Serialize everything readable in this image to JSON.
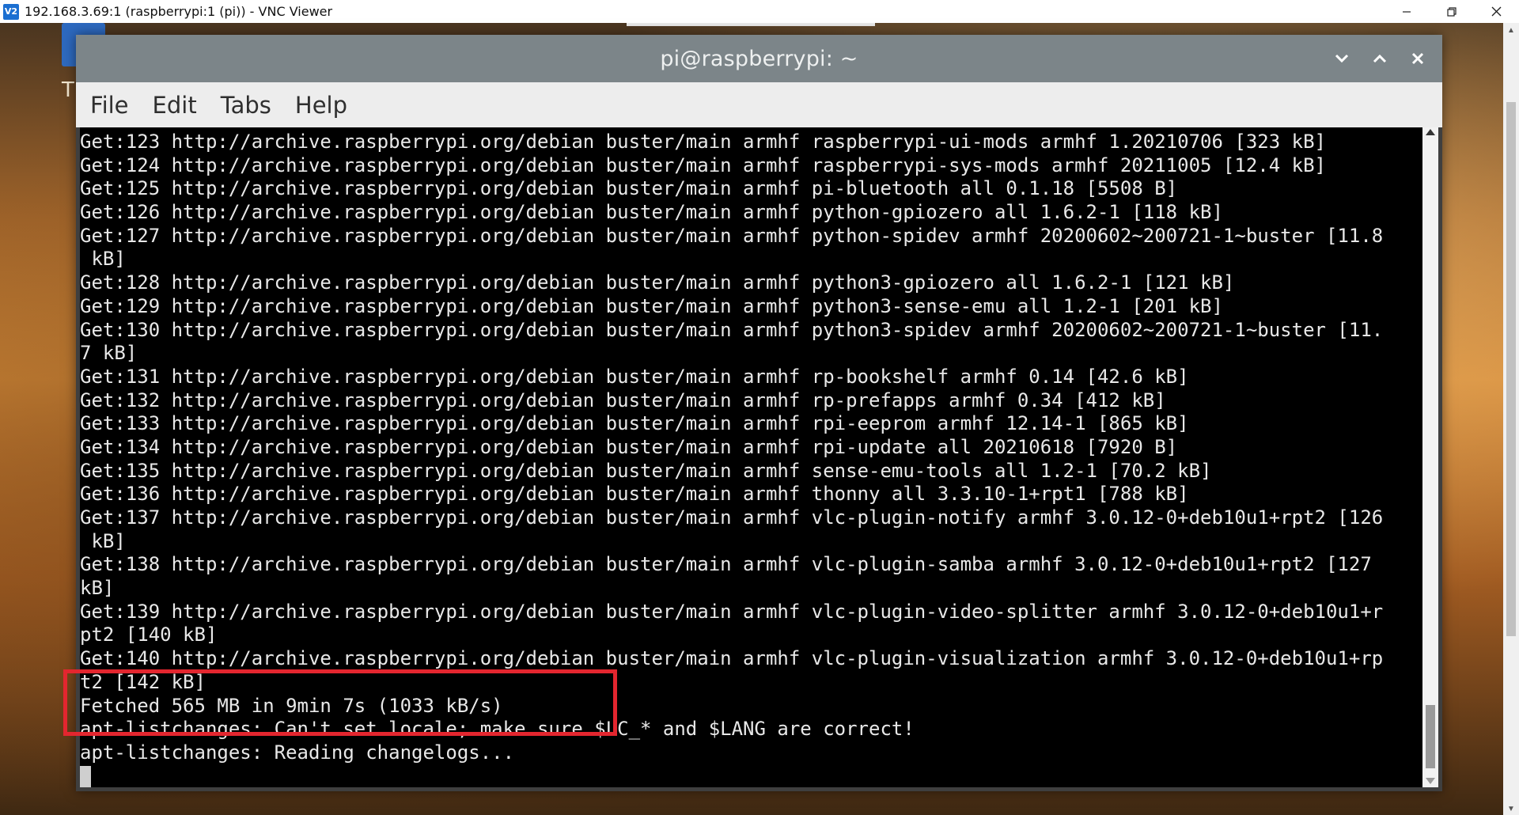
{
  "vnc": {
    "logo": "V2",
    "title": "192.168.3.69:1 (raspberrypi:1 (pi)) - VNC Viewer"
  },
  "desktop": {
    "partial_label": "T"
  },
  "terminal": {
    "title": "pi@raspberrypi: ~",
    "menu": [
      "File",
      "Edit",
      "Tabs",
      "Help"
    ],
    "lines": [
      "Get:123 http://archive.raspberrypi.org/debian buster/main armhf raspberrypi-ui-mods armhf 1.20210706 [323 kB]",
      "Get:124 http://archive.raspberrypi.org/debian buster/main armhf raspberrypi-sys-mods armhf 20211005 [12.4 kB]",
      "Get:125 http://archive.raspberrypi.org/debian buster/main armhf pi-bluetooth all 0.1.18 [5508 B]",
      "Get:126 http://archive.raspberrypi.org/debian buster/main armhf python-gpiozero all 1.6.2-1 [118 kB]",
      "Get:127 http://archive.raspberrypi.org/debian buster/main armhf python-spidev armhf 20200602~200721-1~buster [11.8",
      " kB]",
      "Get:128 http://archive.raspberrypi.org/debian buster/main armhf python3-gpiozero all 1.6.2-1 [121 kB]",
      "Get:129 http://archive.raspberrypi.org/debian buster/main armhf python3-sense-emu all 1.2-1 [201 kB]",
      "Get:130 http://archive.raspberrypi.org/debian buster/main armhf python3-spidev armhf 20200602~200721-1~buster [11.",
      "7 kB]",
      "Get:131 http://archive.raspberrypi.org/debian buster/main armhf rp-bookshelf armhf 0.14 [42.6 kB]",
      "Get:132 http://archive.raspberrypi.org/debian buster/main armhf rp-prefapps armhf 0.34 [412 kB]",
      "Get:133 http://archive.raspberrypi.org/debian buster/main armhf rpi-eeprom armhf 12.14-1 [865 kB]",
      "Get:134 http://archive.raspberrypi.org/debian buster/main armhf rpi-update all 20210618 [7920 B]",
      "Get:135 http://archive.raspberrypi.org/debian buster/main armhf sense-emu-tools all 1.2-1 [70.2 kB]",
      "Get:136 http://archive.raspberrypi.org/debian buster/main armhf thonny all 3.3.10-1+rpt1 [788 kB]",
      "Get:137 http://archive.raspberrypi.org/debian buster/main armhf vlc-plugin-notify armhf 3.0.12-0+deb10u1+rpt2 [126",
      " kB]",
      "Get:138 http://archive.raspberrypi.org/debian buster/main armhf vlc-plugin-samba armhf 3.0.12-0+deb10u1+rpt2 [127",
      "kB]",
      "Get:139 http://archive.raspberrypi.org/debian buster/main armhf vlc-plugin-video-splitter armhf 3.0.12-0+deb10u1+r",
      "pt2 [140 kB]",
      "Get:140 http://archive.raspberrypi.org/debian buster/main armhf vlc-plugin-visualization armhf 3.0.12-0+deb10u1+rp",
      "t2 [142 kB]",
      "Fetched 565 MB in 9min 7s (1033 kB/s)",
      "apt-listchanges: Can't set locale; make sure $LC_* and $LANG are correct!",
      "apt-listchanges: Reading changelogs..."
    ]
  },
  "colors": {
    "annotation": "#e3262f",
    "terminal_bg": "#000000",
    "titlebar": "#7c8589"
  }
}
